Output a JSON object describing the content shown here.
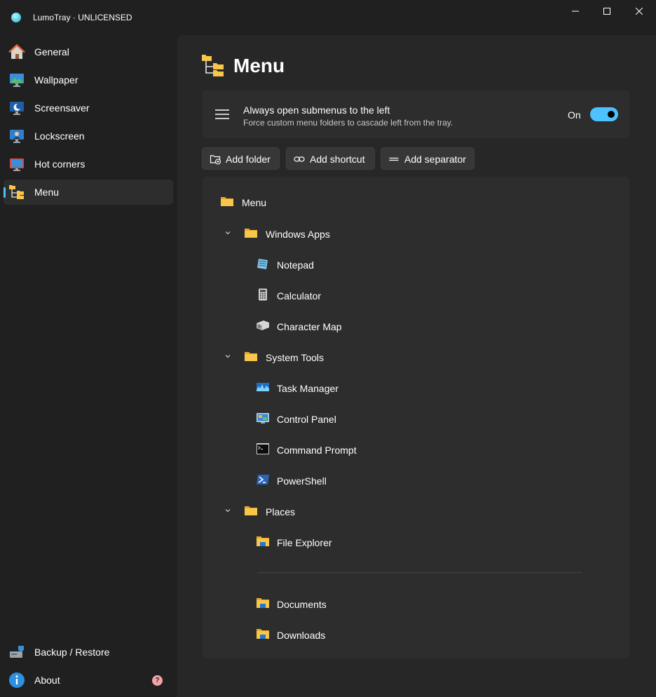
{
  "window": {
    "title": "LumoTray · UNLICENSED",
    "controls": {
      "minimize": "—",
      "maximize": "☐",
      "close": "✕"
    }
  },
  "sidebar": {
    "items": [
      {
        "label": "General",
        "icon": "home-icon"
      },
      {
        "label": "Wallpaper",
        "icon": "wallpaper-icon"
      },
      {
        "label": "Screensaver",
        "icon": "screensaver-icon"
      },
      {
        "label": "Lockscreen",
        "icon": "lockscreen-icon"
      },
      {
        "label": "Hot corners",
        "icon": "hot-corners-icon"
      },
      {
        "label": "Menu",
        "icon": "menu-tree-icon",
        "selected": true
      }
    ],
    "footer": [
      {
        "label": "Backup / Restore",
        "icon": "backup-icon"
      },
      {
        "label": "About",
        "icon": "info-icon",
        "badge": "?"
      }
    ]
  },
  "page": {
    "title": "Menu",
    "setting": {
      "title": "Always open submenus to the left",
      "description": "Force custom menu folders to cascade left from the tray.",
      "state_label": "On",
      "enabled": true
    },
    "buttons": {
      "add_folder": "Add folder",
      "add_shortcut": "Add shortcut",
      "add_separator": "Add separator"
    },
    "tree": {
      "root": "Menu",
      "groups": [
        {
          "label": "Windows Apps",
          "items": [
            "Notepad",
            "Calculator",
            "Character Map"
          ]
        },
        {
          "label": "System Tools",
          "items": [
            "Task Manager",
            "Control Panel",
            "Command Prompt",
            "PowerShell"
          ]
        },
        {
          "label": "Places",
          "items": [
            "File Explorer",
            "Documents",
            "Downloads"
          ]
        }
      ]
    }
  },
  "colors": {
    "accent": "#4cc2ff",
    "window_bg": "#202020",
    "content_bg": "#272727",
    "card_bg": "#2d2d2d",
    "folder_yellow": "#f8c74a",
    "badge": "#f4a3a8"
  }
}
